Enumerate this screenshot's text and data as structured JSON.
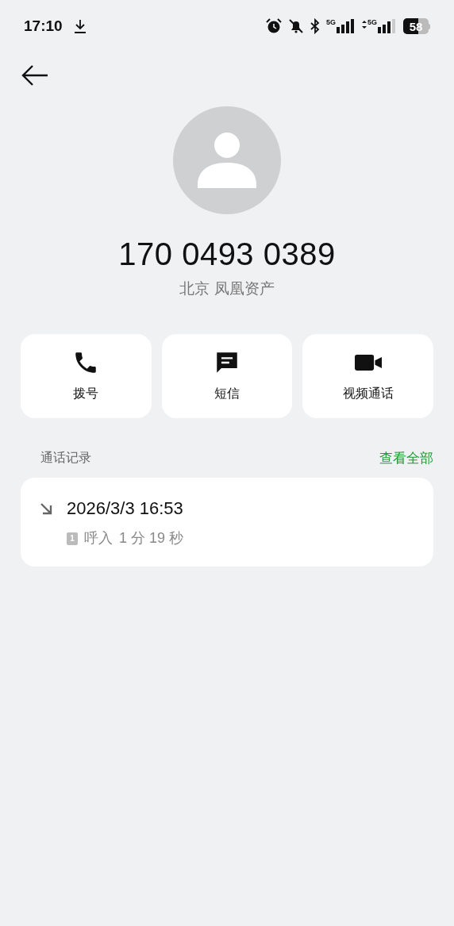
{
  "status_bar": {
    "time": "17:10",
    "signals": [
      "5G",
      "5G"
    ],
    "battery": "58"
  },
  "contact": {
    "number": "170 0493 0389",
    "location": "北京 凤凰资产"
  },
  "actions": [
    {
      "kind": "call",
      "label": "拨号"
    },
    {
      "kind": "message",
      "label": "短信"
    },
    {
      "kind": "video",
      "label": "视频通话"
    }
  ],
  "call_log": {
    "title": "通话记录",
    "view_all": "查看全部",
    "entries": [
      {
        "kind": "incoming",
        "datetime": "2026/3/3 16:53",
        "sim": "1",
        "type": "呼入",
        "duration": "1 分 19 秒"
      }
    ]
  }
}
